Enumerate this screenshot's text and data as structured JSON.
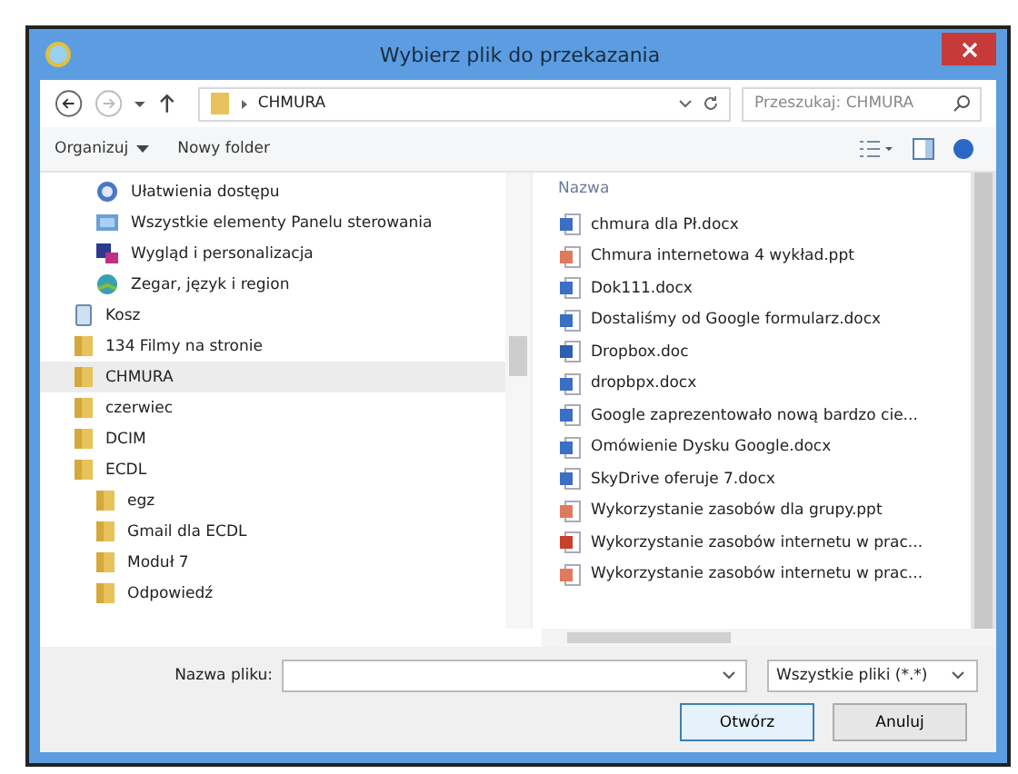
{
  "window": {
    "title": "Wybierz plik do przekazania"
  },
  "address": {
    "path": "CHMURA",
    "search_placeholder": "Przeszukaj: CHMURA"
  },
  "toolbar": {
    "organize": "Organizuj",
    "new_folder": "Nowy folder"
  },
  "tree": [
    {
      "label": "Ułatwienia dostępu",
      "kind": "applet",
      "selected": false
    },
    {
      "label": "Wszystkie elementy Panelu sterowania",
      "kind": "applet",
      "selected": false
    },
    {
      "label": "Wygląd i personalizacja",
      "kind": "applet",
      "selected": false
    },
    {
      "label": "Zegar, język i region",
      "kind": "applet",
      "selected": false
    },
    {
      "label": "Kosz",
      "kind": "bin",
      "selected": false
    },
    {
      "label": "134 Filmy na stronie",
      "kind": "folder",
      "selected": false
    },
    {
      "label": "CHMURA",
      "kind": "folder",
      "selected": true
    },
    {
      "label": "czerwiec",
      "kind": "folder",
      "selected": false
    },
    {
      "label": "DCIM",
      "kind": "folder",
      "selected": false
    },
    {
      "label": "ECDL",
      "kind": "folder",
      "selected": false,
      "children": [
        {
          "label": "egz",
          "kind": "folder",
          "selected": false
        },
        {
          "label": "Gmail dla ECDL",
          "kind": "folder",
          "selected": false
        },
        {
          "label": "Moduł 7",
          "kind": "folder",
          "selected": false
        },
        {
          "label": "Odpowiedź",
          "kind": "folder",
          "selected": false
        }
      ]
    }
  ],
  "files": {
    "column": "Nazwa",
    "items": [
      {
        "name": "chmura dla Pł.docx",
        "kind": "docx"
      },
      {
        "name": "Chmura internetowa  4 wykład.ppt",
        "kind": "ppt"
      },
      {
        "name": "Dok111.docx",
        "kind": "docx"
      },
      {
        "name": "Dostaliśmy od Google formularz.docx",
        "kind": "docx"
      },
      {
        "name": "Dropbox.doc",
        "kind": "doc"
      },
      {
        "name": "dropbpx.docx",
        "kind": "docx"
      },
      {
        "name": "Google zaprezentowało nową bardzo cie...",
        "kind": "docx"
      },
      {
        "name": "Omówienie Dysku Google.docx",
        "kind": "docx"
      },
      {
        "name": "SkyDrive oferuje 7.docx",
        "kind": "docx"
      },
      {
        "name": "Wykorzystanie zasobów dla grupy.ppt",
        "kind": "ppt"
      },
      {
        "name": "Wykorzystanie zasobów internetu w prac...",
        "kind": "pptx"
      },
      {
        "name": "Wykorzystanie zasobów internetu w prac...",
        "kind": "ppt"
      }
    ]
  },
  "bottom": {
    "filename_label": "Nazwa pliku:",
    "filter": "Wszystkie pliki (*.*)",
    "open": "Otwórz",
    "cancel": "Anuluj"
  }
}
